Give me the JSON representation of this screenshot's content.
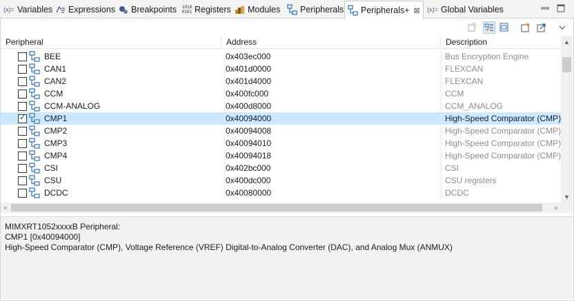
{
  "tabs": [
    {
      "label": "Variables",
      "icon": "variables-icon",
      "active": false
    },
    {
      "label": "Expressions",
      "icon": "expressions-icon",
      "active": false
    },
    {
      "label": "Breakpoints",
      "icon": "breakpoints-icon",
      "active": false
    },
    {
      "label": "Registers",
      "icon": "registers-icon",
      "active": false
    },
    {
      "label": "Modules",
      "icon": "modules-icon",
      "active": false
    },
    {
      "label": "Peripherals",
      "icon": "peripherals-icon",
      "active": false
    },
    {
      "label": "Peripherals+",
      "icon": "peripherals-plus-icon",
      "active": true,
      "close_label": "⊠"
    },
    {
      "label": "Global Variables",
      "icon": "global-variables-icon",
      "active": false
    }
  ],
  "tab_icon_text": {
    "variables": "(x)=",
    "global": "(x)=",
    "registers_top": "1010",
    "registers_bottom": "0101"
  },
  "table": {
    "columns": [
      "Peripheral",
      "Address",
      "Description"
    ],
    "rows": [
      {
        "name": "BEE",
        "address": "0x403ec000",
        "description": "Bus Encryption Engine",
        "checked": false,
        "selected": false
      },
      {
        "name": "CAN1",
        "address": "0x401d0000",
        "description": "FLEXCAN",
        "checked": false,
        "selected": false
      },
      {
        "name": "CAN2",
        "address": "0x401d4000",
        "description": "FLEXCAN",
        "checked": false,
        "selected": false
      },
      {
        "name": "CCM",
        "address": "0x400fc000",
        "description": "CCM",
        "checked": false,
        "selected": false
      },
      {
        "name": "CCM-ANALOG",
        "address": "0x400d8000",
        "description": "CCM_ANALOG",
        "checked": false,
        "selected": false
      },
      {
        "name": "CMP1",
        "address": "0x40094000",
        "description": "High-Speed Comparator (CMP),",
        "checked": true,
        "selected": true
      },
      {
        "name": "CMP2",
        "address": "0x40094008",
        "description": "High-Speed Comparator (CMP),",
        "checked": false,
        "selected": false
      },
      {
        "name": "CMP3",
        "address": "0x40094010",
        "description": "High-Speed Comparator (CMP),",
        "checked": false,
        "selected": false
      },
      {
        "name": "CMP4",
        "address": "0x40094018",
        "description": "High-Speed Comparator (CMP),",
        "checked": false,
        "selected": false
      },
      {
        "name": "CSI",
        "address": "0x402bc000",
        "description": "CSI",
        "checked": false,
        "selected": false
      },
      {
        "name": "CSU",
        "address": "0x400dc000",
        "description": "CSU registers",
        "checked": false,
        "selected": false
      },
      {
        "name": "DCDC",
        "address": "0x40080000",
        "description": "DCDC",
        "checked": false,
        "selected": false
      }
    ]
  },
  "details": {
    "line1": "MIMXRT1052xxxxB Peripheral:",
    "line2": "CMP1 [0x40094000]",
    "line3": "High-Speed Comparator (CMP), Voltage Reference (VREF) Digital-to-Analog Converter (DAC), and Analog Mux (ANMUX)"
  },
  "colors": {
    "selection": "#cce8ff",
    "accent": "#2d6fb5",
    "description_text": "#8c8c8c"
  }
}
